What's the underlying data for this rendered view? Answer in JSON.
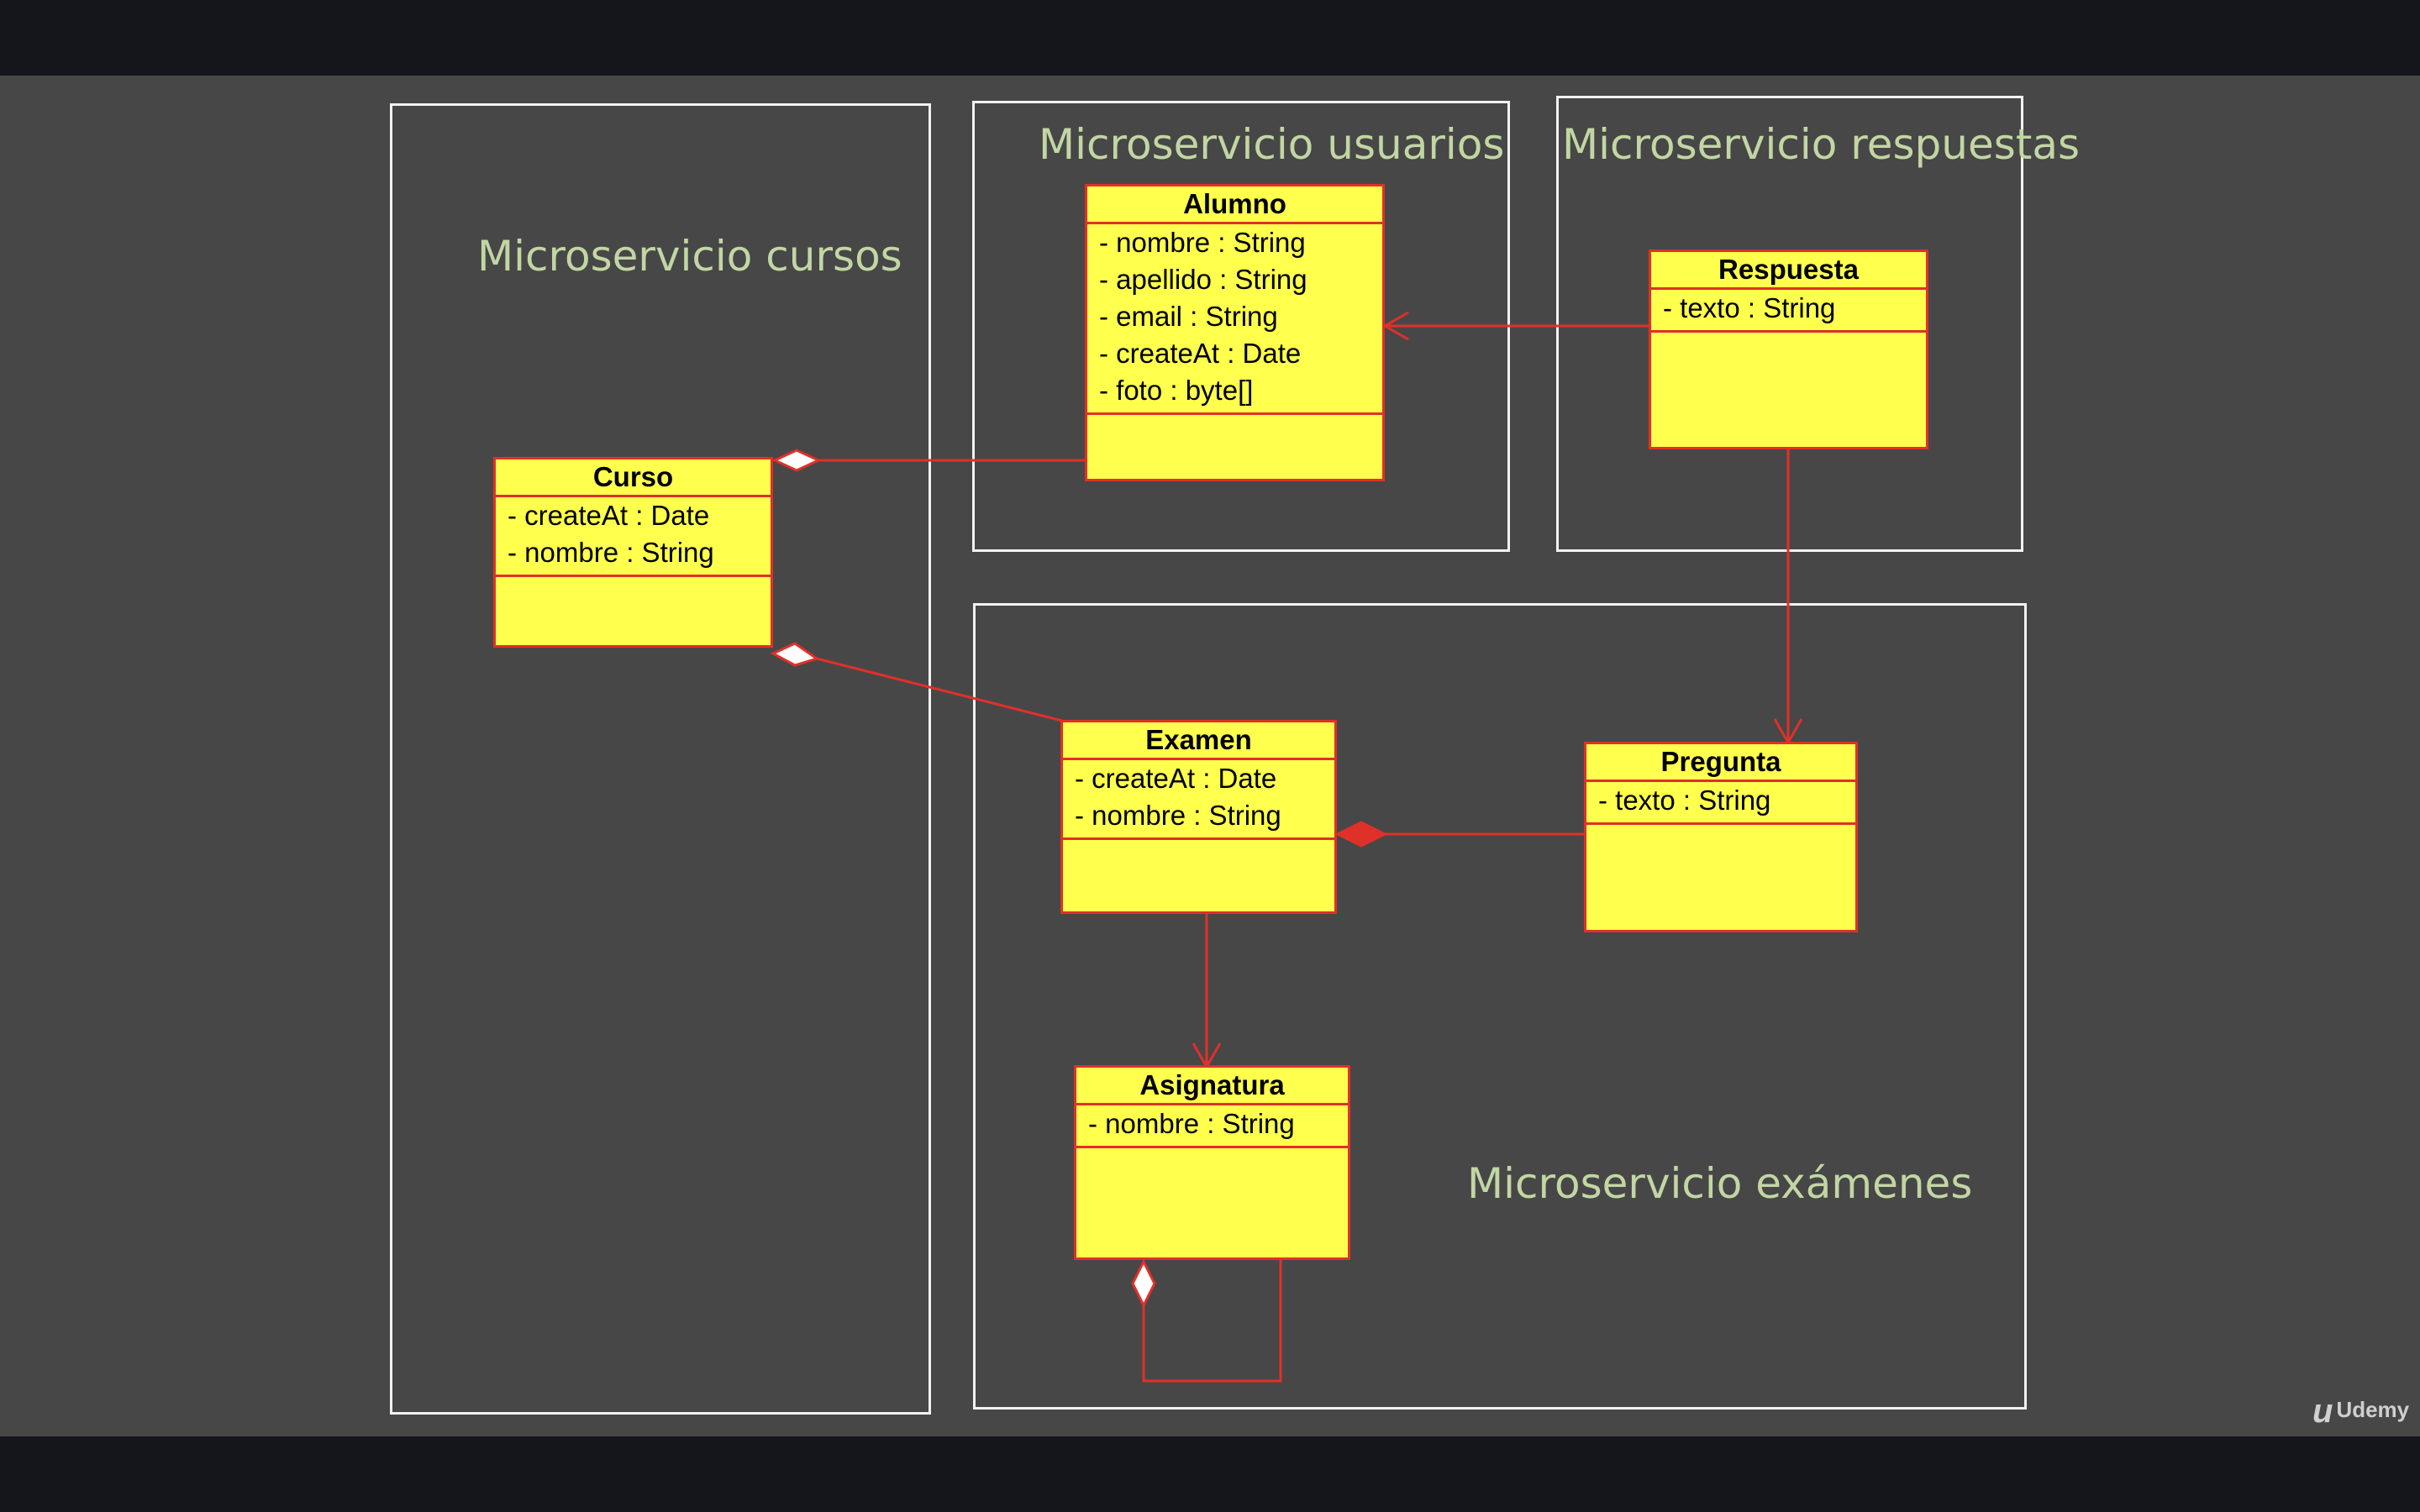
{
  "packages": {
    "cursos": "Microservicio cursos",
    "usuarios": "Microservicio usuarios",
    "respuestas": "Microservicio respuestas",
    "examenes": "Microservicio exámenes"
  },
  "classes": {
    "alumno": {
      "name": "Alumno",
      "attributes": [
        "- nombre : String",
        "- apellido : String",
        "- email : String",
        "- createAt : Date",
        "- foto : byte[]"
      ]
    },
    "respuesta": {
      "name": "Respuesta",
      "attributes": [
        "- texto : String"
      ]
    },
    "curso": {
      "name": "Curso",
      "attributes": [
        "- createAt : Date",
        "- nombre : String"
      ]
    },
    "examen": {
      "name": "Examen",
      "attributes": [
        "- createAt : Date",
        "- nombre : String"
      ]
    },
    "pregunta": {
      "name": "Pregunta",
      "attributes": [
        "- texto : String"
      ]
    },
    "asignatura": {
      "name": "Asignatura",
      "attributes": [
        "- nombre : String"
      ]
    }
  },
  "relations": [
    {
      "from": "Curso",
      "to": "Alumno",
      "kind": "aggregation"
    },
    {
      "from": "Curso",
      "to": "Examen",
      "kind": "aggregation"
    },
    {
      "from": "Respuesta",
      "to": "Alumno",
      "kind": "association"
    },
    {
      "from": "Respuesta",
      "to": "Pregunta",
      "kind": "association"
    },
    {
      "from": "Examen",
      "to": "Pregunta",
      "kind": "composition"
    },
    {
      "from": "Examen",
      "to": "Asignatura",
      "kind": "association"
    },
    {
      "from": "Asignatura",
      "to": "Asignatura",
      "kind": "aggregation"
    }
  ],
  "colors": {
    "class_fill": "#ffff4d",
    "class_border": "#e0302a",
    "package_border": "#f2f2f2",
    "package_title": "#c2d6a4",
    "background": "#474747"
  },
  "watermark": {
    "logo": "u",
    "text": "Udemy"
  }
}
